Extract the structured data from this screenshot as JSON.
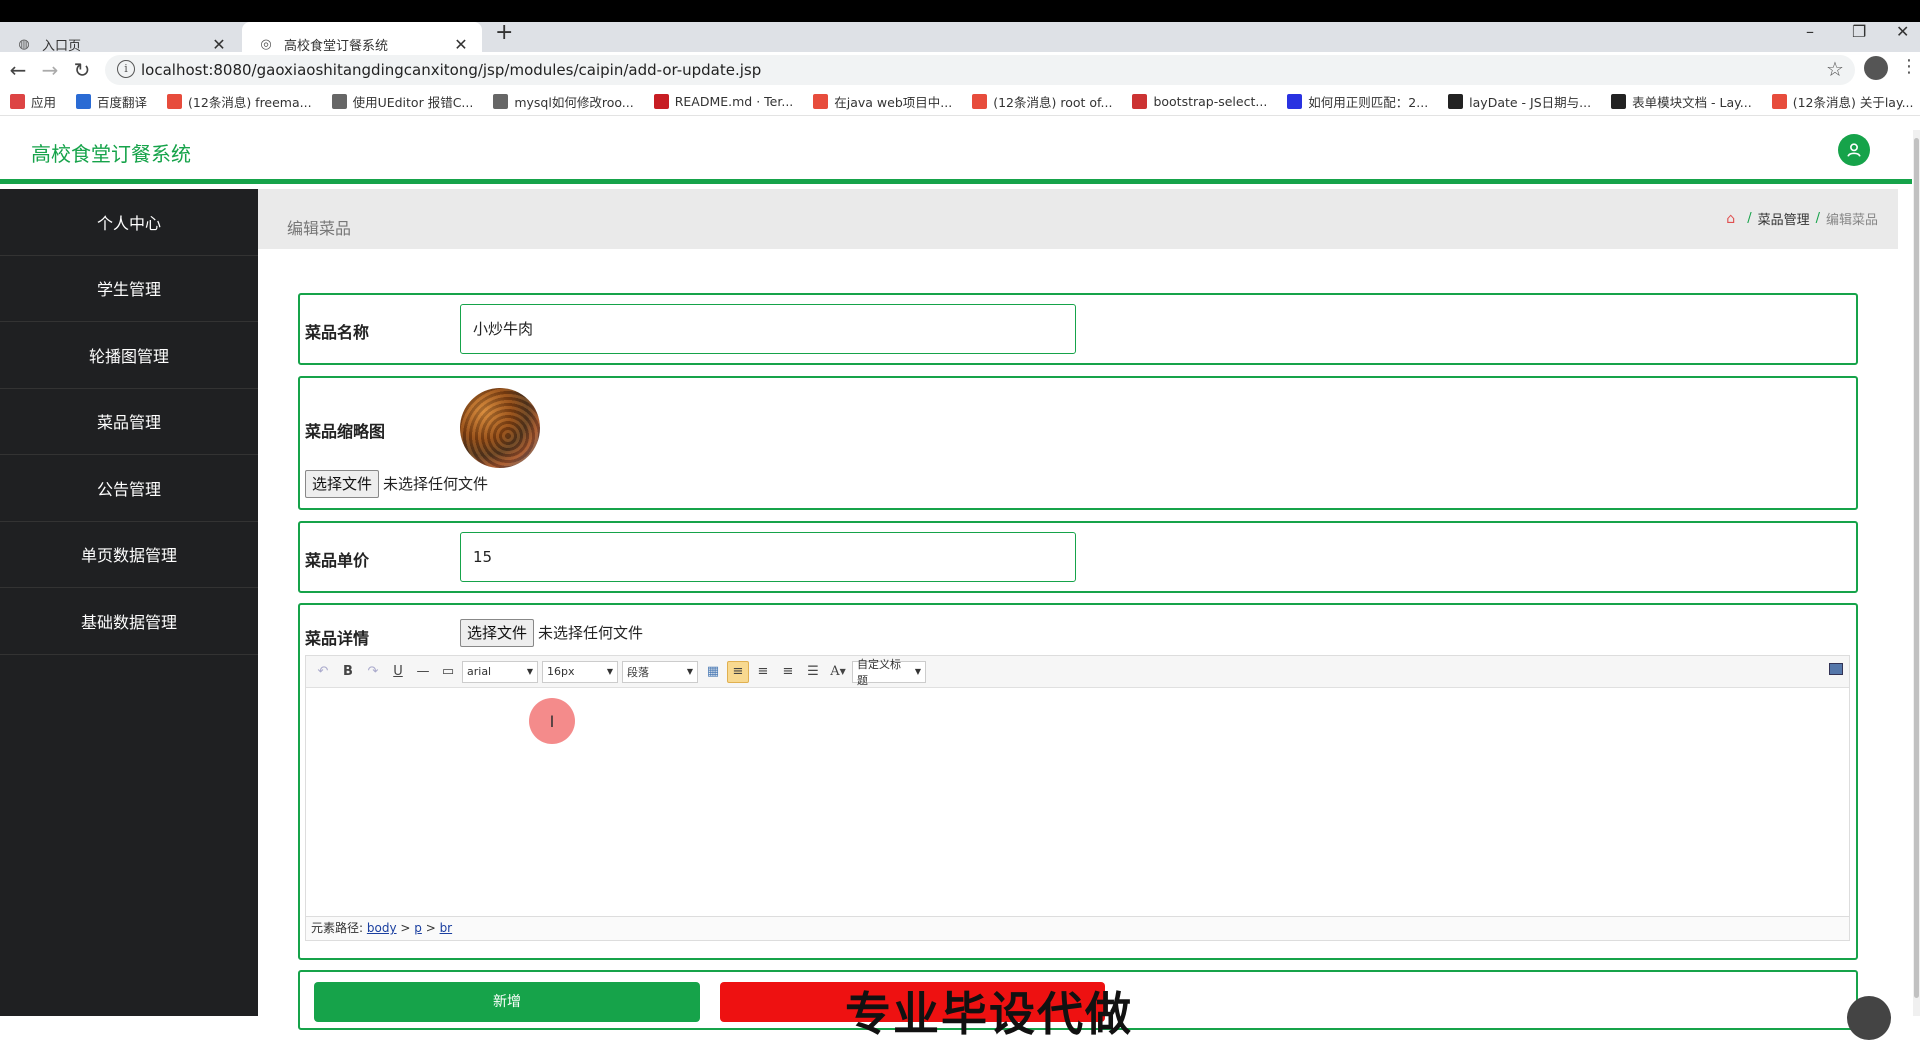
{
  "browser": {
    "tabs": [
      {
        "title": "入口页",
        "icon": "globe-icon"
      },
      {
        "title": "高校食堂订餐系统",
        "icon": "shield-icon"
      }
    ],
    "url": "localhost:8080/gaoxiaoshitangdingcanxitong/jsp/modules/caipin/add-or-update.jsp",
    "bookmarks": [
      {
        "label": "应用",
        "icon": "apps-icon",
        "color": "#d44"
      },
      {
        "label": "百度翻译",
        "icon": "baidu-translate-icon",
        "color": "#2a6bd4"
      },
      {
        "label": "(12条消息) freema...",
        "icon": "csdn-icon",
        "color": "#e74c3c"
      },
      {
        "label": "使用UEditor 报错C...",
        "icon": "fox-icon",
        "color": "#666"
      },
      {
        "label": "mysql如何修改roo...",
        "icon": "fox-icon",
        "color": "#666"
      },
      {
        "label": "README.md · Ter...",
        "icon": "gitee-icon",
        "color": "#c71d23"
      },
      {
        "label": "在java web项目中...",
        "icon": "csdn-icon",
        "color": "#e74c3c"
      },
      {
        "label": "(12条消息) root of...",
        "icon": "csdn-icon",
        "color": "#e74c3c"
      },
      {
        "label": "bootstrap-select...",
        "icon": "bootstrap-icon",
        "color": "#c33"
      },
      {
        "label": "如何用正则匹配：2...",
        "icon": "baidu-icon",
        "color": "#2932e1"
      },
      {
        "label": "layDate - JS日期与...",
        "icon": "layui-icon",
        "color": "#222"
      },
      {
        "label": "表单模块文档 - Lay...",
        "icon": "layui-icon",
        "color": "#222"
      },
      {
        "label": "(12条消息) 关于lay...",
        "icon": "csdn-icon",
        "color": "#e74c3c"
      }
    ]
  },
  "app": {
    "title": "高校食堂订餐系统",
    "accent": "#16a34a"
  },
  "sidebar": {
    "items": [
      {
        "label": "个人中心"
      },
      {
        "label": "学生管理"
      },
      {
        "label": "轮播图管理"
      },
      {
        "label": "菜品管理"
      },
      {
        "label": "公告管理"
      },
      {
        "label": "单页数据管理"
      },
      {
        "label": "基础数据管理"
      }
    ]
  },
  "page": {
    "title": "编辑菜品",
    "breadcrumb": {
      "parent": "菜品管理",
      "sep": "/",
      "current": "编辑菜品"
    }
  },
  "form": {
    "name_label": "菜品名称",
    "name_value": "小炒牛肉",
    "thumb_label": "菜品缩略图",
    "file_button": "选择文件",
    "file_none": "未选择任何文件",
    "price_label": "菜品单价",
    "price_value": "15",
    "detail_label": "菜品详情",
    "submit_label": "新增"
  },
  "editor": {
    "font": "arial",
    "size": "16px",
    "paragraph": "段落",
    "custom_title": "自定义标题",
    "path_label": "元素路径:",
    "path": [
      "body",
      "p",
      "br"
    ]
  },
  "ad": {
    "text": "专业毕设代做"
  }
}
